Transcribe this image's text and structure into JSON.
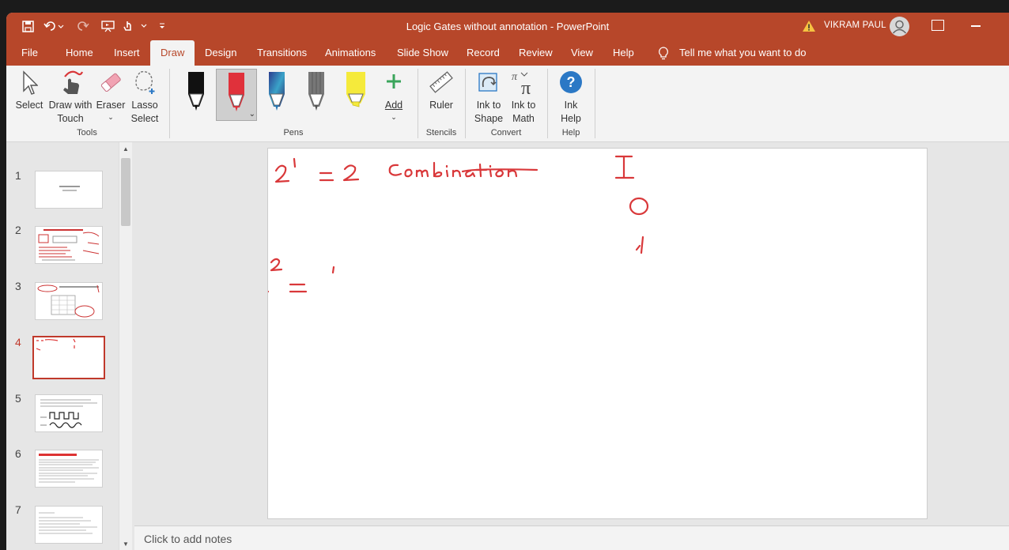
{
  "titlebar": {
    "title": "Logic Gates without annotation  -  PowerPoint",
    "user": "VIKRAM  PAUL"
  },
  "tabs": [
    "File",
    "Home",
    "Insert",
    "Draw",
    "Design",
    "Transitions",
    "Animations",
    "Slide Show",
    "Record",
    "Review",
    "View",
    "Help"
  ],
  "active_tab": "Draw",
  "tell_me": "Tell me what you want to do",
  "ribbon": {
    "tools": {
      "select": "Select",
      "draw_touch_1": "Draw with",
      "draw_touch_2": "Touch",
      "eraser": "Eraser",
      "lasso_1": "Lasso",
      "lasso_2": "Select",
      "group": "Tools"
    },
    "pens": {
      "add": "Add",
      "group": "Pens"
    },
    "stencils": {
      "ruler": "Ruler",
      "group": "Stencils"
    },
    "convert": {
      "ink_shape_1": "Ink to",
      "ink_shape_2": "Shape",
      "ink_math_1": "Ink to",
      "ink_math_2": "Math",
      "group": "Convert"
    },
    "help": {
      "ink_help_1": "Ink",
      "ink_help_2": "Help",
      "group": "Help"
    }
  },
  "slides": [
    {
      "num": "1"
    },
    {
      "num": "2"
    },
    {
      "num": "3"
    },
    {
      "num": "4"
    },
    {
      "num": "5"
    },
    {
      "num": "6"
    },
    {
      "num": "7"
    }
  ],
  "active_slide": "4",
  "notes_placeholder": "Click to add notes",
  "colors": {
    "accent": "#b7472a",
    "ink": "#d9383a",
    "active_border": "#c0392b"
  }
}
